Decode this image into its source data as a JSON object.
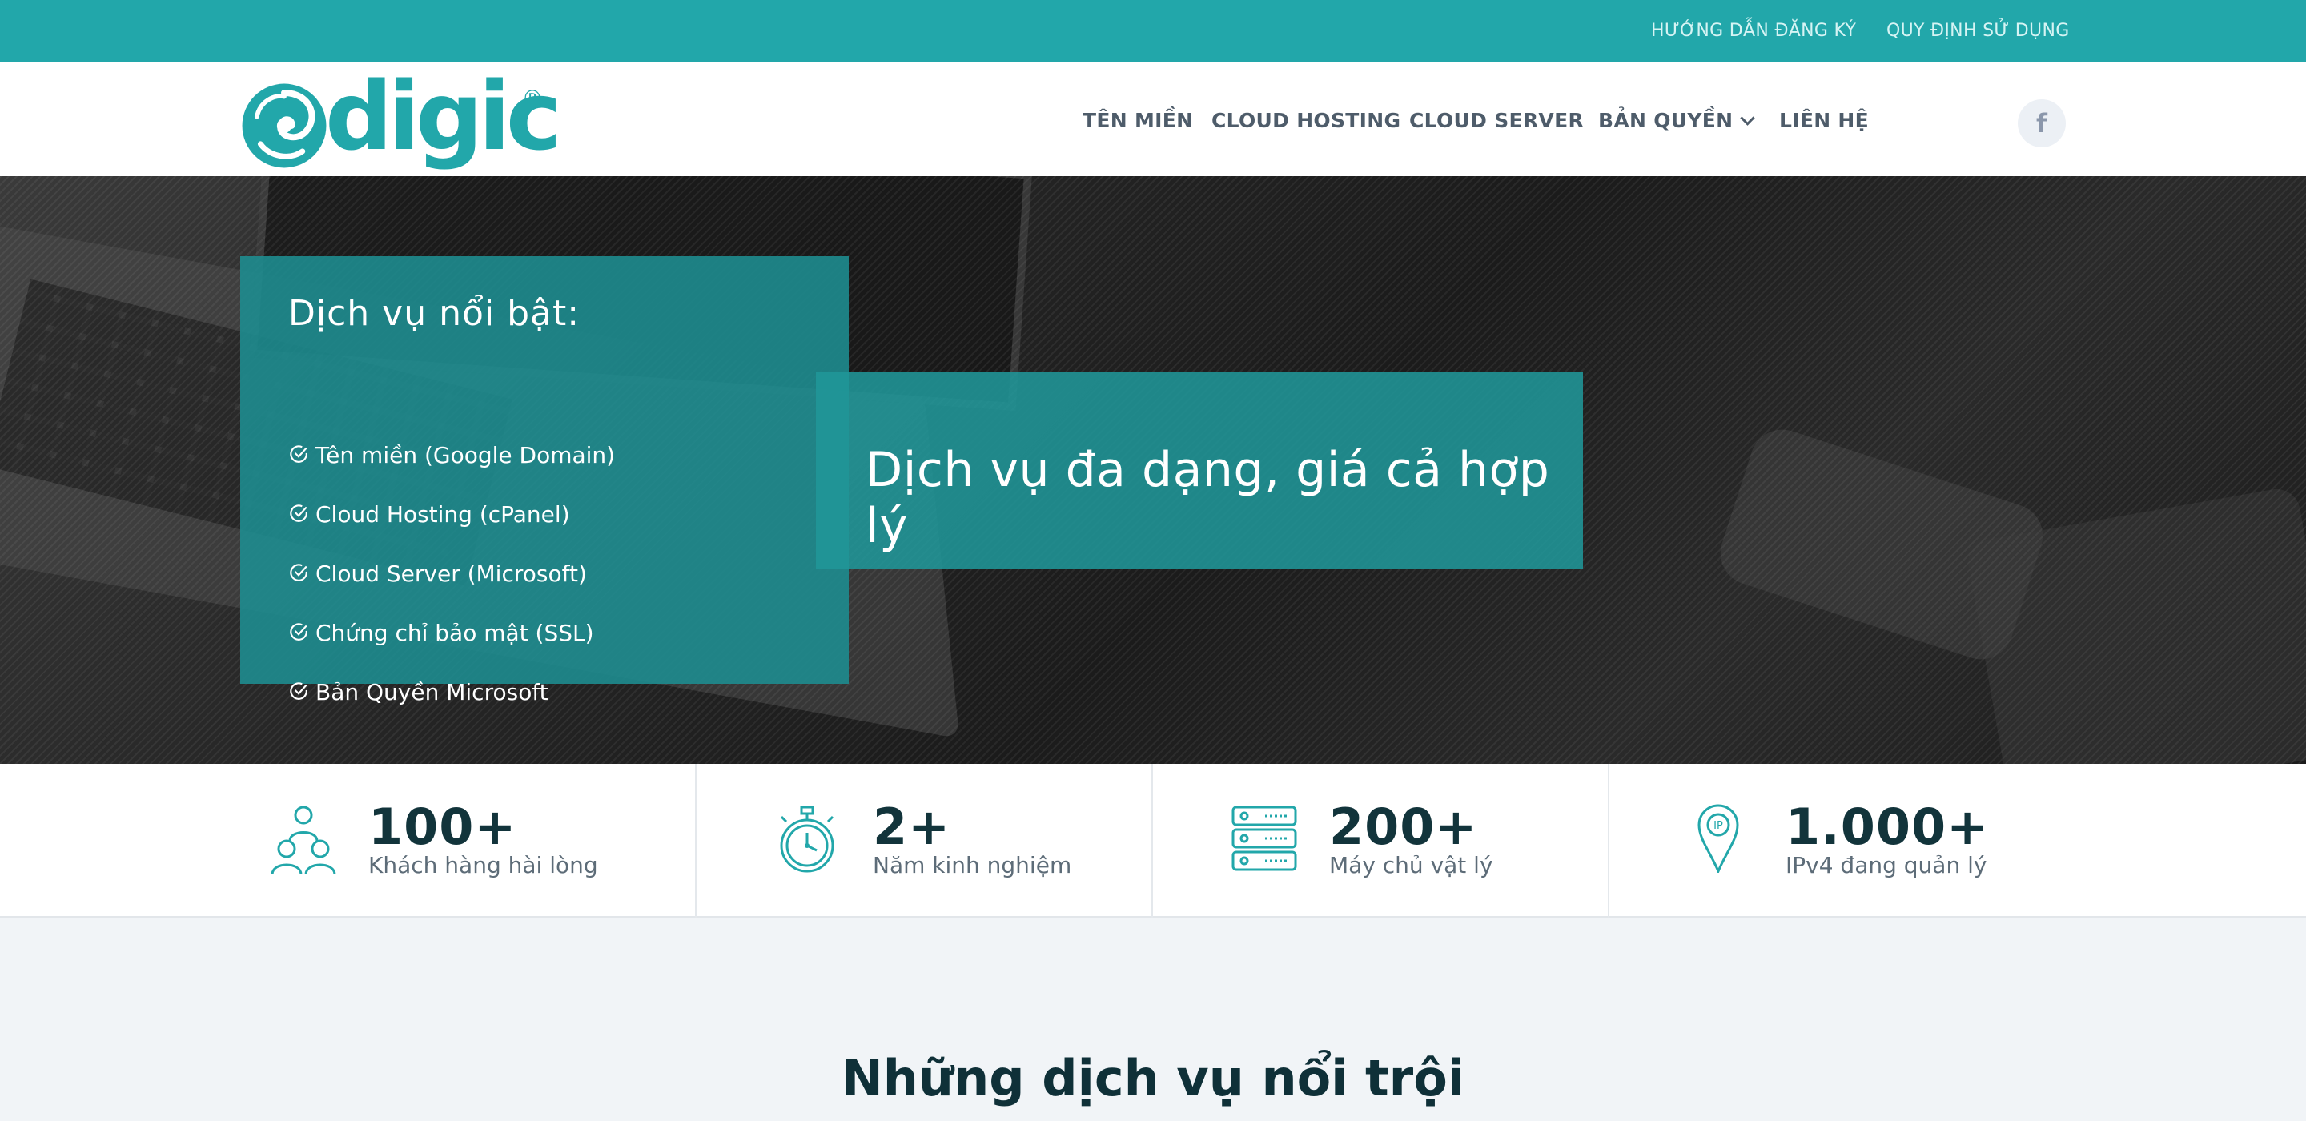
{
  "topbar": {
    "link1": "HƯỚNG DẪN ĐĂNG KÝ",
    "link2": "QUY ĐỊNH SỬ DỤNG",
    "bg": "#22a7aa"
  },
  "logo": {
    "text": "digic",
    "reg": "®",
    "color": "#22a7aa"
  },
  "nav": {
    "items": [
      "TÊN MIỀN",
      "CLOUD HOSTING",
      "CLOUD SERVER",
      "BẢN QUYỀN",
      "LIÊN HỆ"
    ],
    "facebook": "f"
  },
  "hero": {
    "feature_title": "Dịch vụ nổi bật:",
    "features": [
      "Tên miền (Google Domain)",
      "Cloud Hosting (cPanel)",
      "Cloud Server (Microsoft)",
      "Chứng chỉ bảo mật (SSL)",
      "Bản Quyền Microsoft"
    ],
    "slogan": "Dịch vụ đa dạng, giá cả hợp lý"
  },
  "stats": [
    {
      "icon": "users-icon",
      "number": "100+",
      "label": "Khách hàng hài lòng"
    },
    {
      "icon": "stopwatch-icon",
      "number": "2+",
      "label": "Năm kinh nghiệm"
    },
    {
      "icon": "server-icon",
      "number": "200+",
      "label": "Máy chủ vật lý"
    },
    {
      "icon": "ip-pin-icon",
      "number": "1.000+",
      "label": "IPv4 đang quản lý"
    }
  ],
  "section": {
    "title": "Những dịch vụ nổi trội"
  }
}
